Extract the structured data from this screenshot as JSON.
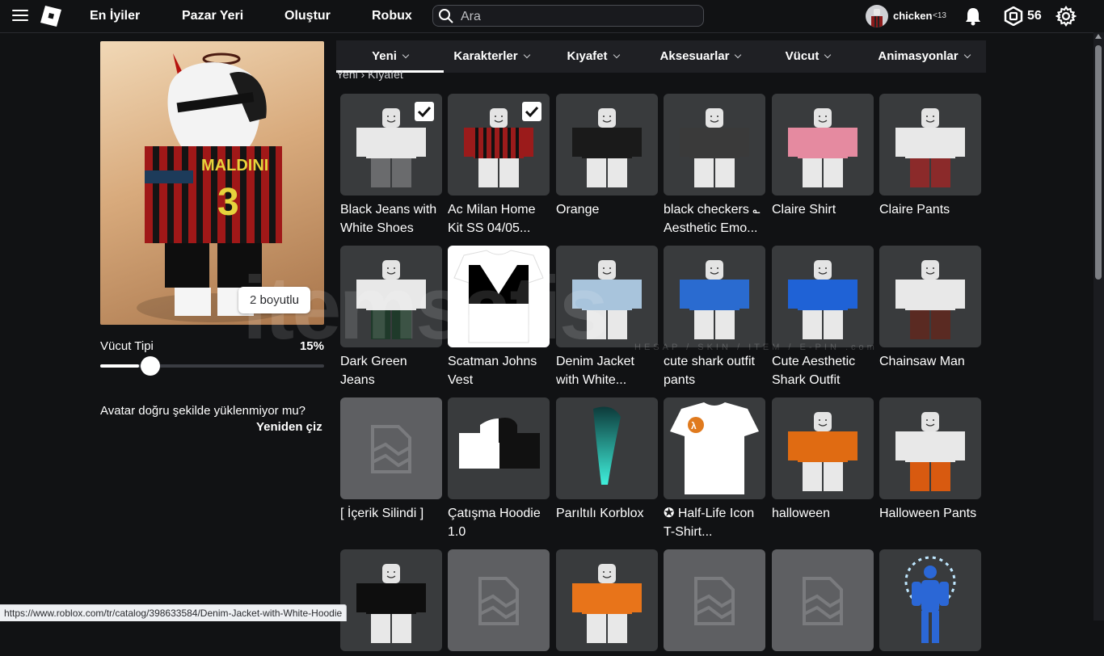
{
  "header": {
    "nav": [
      "En İyiler",
      "Pazar Yeri",
      "Oluştur",
      "Robux"
    ],
    "search_placeholder": "Ara",
    "username": "chicken",
    "age_badge": "<13",
    "robux_balance": "56",
    "icons": [
      "menu-icon",
      "roblox-logo",
      "search-icon",
      "bell-icon",
      "robux-icon",
      "gear-icon"
    ]
  },
  "avatar_panel": {
    "view_toggle": "2 boyutlu",
    "body_type_label": "Vücut Tipi",
    "body_type_value": "15%",
    "body_type_fraction": 0.15,
    "fix_question": "Avatar doğru şekilde yüklenmiyor mu?",
    "redraw_label": "Yeniden çiz"
  },
  "tabs": [
    "Yeni",
    "Karakterler",
    "Kıyafet",
    "Aksesuarlar",
    "Vücut",
    "Animasyonlar"
  ],
  "active_tab": "Yeni",
  "breadcrumb": "Yeni › Kıyafet",
  "items": [
    {
      "name": "Black Jeans with White Shoes",
      "checked": true,
      "thumb": "pants",
      "color": "#6a6b6d"
    },
    {
      "name": "Ac Milan Home Kit SS 04/05...",
      "checked": true,
      "thumb": "shirt-stripe",
      "color": "#9b1b1b"
    },
    {
      "name": "Orange",
      "checked": false,
      "thumb": "shirt",
      "color": "#1a1a1a"
    },
    {
      "name": "black checkers ؎ Aesthetic Emo...",
      "checked": false,
      "thumb": "shirt",
      "color": "#3a3a3a"
    },
    {
      "name": "Claire Shirt",
      "checked": false,
      "thumb": "shirt",
      "color": "#e58aa0"
    },
    {
      "name": "Claire Pants",
      "checked": false,
      "thumb": "pants",
      "color": "#8b2a2a"
    },
    {
      "name": "Dark Green Jeans",
      "checked": false,
      "thumb": "pants",
      "color": "#1f3a2a"
    },
    {
      "name": "Scatman Johns Vest",
      "checked": false,
      "thumb": "tshirt-black",
      "color": "#000000"
    },
    {
      "name": "Denim Jacket with White...",
      "checked": false,
      "thumb": "shirt",
      "color": "#a8c4dc"
    },
    {
      "name": "cute shark outfit pants",
      "checked": false,
      "thumb": "shirt",
      "color": "#2a6bd0"
    },
    {
      "name": "Cute Aesthetic Shark Outfit",
      "checked": false,
      "thumb": "shirt",
      "color": "#1f62d6"
    },
    {
      "name": "Chainsaw Man",
      "checked": false,
      "thumb": "pants",
      "color": "#5a2a22"
    },
    {
      "name": "[ İçerik Silindi ]",
      "checked": false,
      "thumb": "deleted",
      "color": "#5e5f62"
    },
    {
      "name": "Çatışma Hoodie 1.0",
      "checked": false,
      "thumb": "hoodie",
      "color": "#111111"
    },
    {
      "name": "Parıltılı Korblox",
      "checked": false,
      "thumb": "leg",
      "color": "#2ad6c4"
    },
    {
      "name": "✪ Half-Life Icon T-Shirt...",
      "checked": false,
      "thumb": "tshirt-white",
      "color": "#ffffff"
    },
    {
      "name": "halloween",
      "checked": false,
      "thumb": "shirt",
      "color": "#e06b12"
    },
    {
      "name": "Halloween Pants",
      "checked": false,
      "thumb": "pants",
      "color": "#d85a10"
    },
    {
      "name": "",
      "checked": false,
      "thumb": "shirt",
      "color": "#0e0e0e"
    },
    {
      "name": "",
      "checked": false,
      "thumb": "deleted",
      "color": "#5e5f62"
    },
    {
      "name": "",
      "checked": false,
      "thumb": "shirt",
      "color": "#e8741a"
    },
    {
      "name": "",
      "checked": false,
      "thumb": "deleted",
      "color": "#5e5f62"
    },
    {
      "name": "",
      "checked": false,
      "thumb": "deleted",
      "color": "#5e5f62"
    },
    {
      "name": "",
      "checked": false,
      "thumb": "aura",
      "color": "#2b67d6"
    }
  ],
  "status_url": "https://www.roblox.com/tr/catalog/398633584/Denim-Jacket-with-White-Hoodie",
  "watermark": "itemsatis",
  "watermark_sub": "HESAP / SKIN / ITEM / E-PIN .com"
}
